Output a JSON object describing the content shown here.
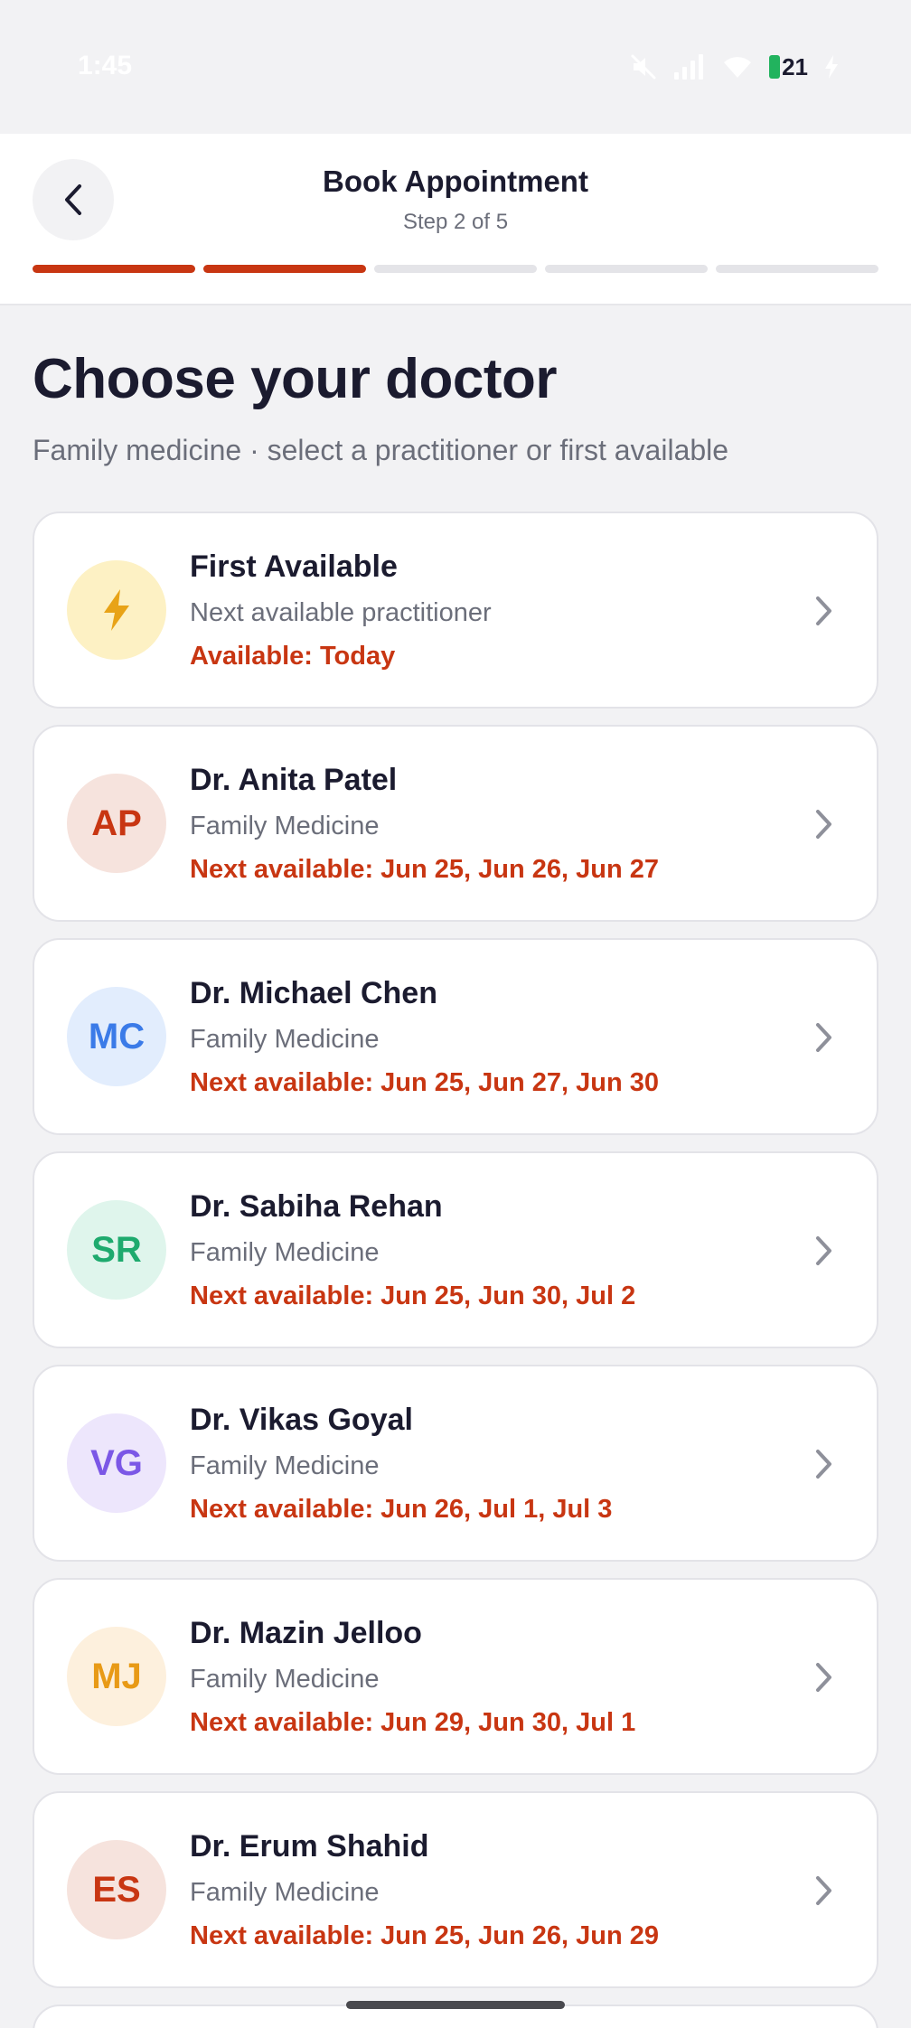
{
  "status_bar": {
    "time": "1:45",
    "battery_level": "21",
    "icons": [
      "mute-icon",
      "signal-icon",
      "wifi-icon",
      "battery-icon",
      "charging-icon"
    ]
  },
  "header": {
    "title": "Book Appointment",
    "step": "Step 2 of 5",
    "progress": {
      "current": 2,
      "total": 5
    },
    "accent_color": "#c83612"
  },
  "main": {
    "title": "Choose your doctor",
    "subtitle": "Family medicine · select a practitioner or first available"
  },
  "options": [
    {
      "type": "first_available",
      "icon": "lightning-icon",
      "name": "First Available",
      "specialty": "Next available practitioner",
      "availability": "Available: Today",
      "avatar_bg": "#fdf1c4",
      "avatar_fg": "#e8a317"
    },
    {
      "type": "doctor",
      "initials": "AP",
      "name": "Dr. Anita Patel",
      "specialty": "Family Medicine",
      "availability": "Next available: Jun 25, Jun 26, Jun 27",
      "avatar_bg": "#f6e3dd",
      "avatar_fg": "#c83612"
    },
    {
      "type": "doctor",
      "initials": "MC",
      "name": "Dr. Michael Chen",
      "specialty": "Family Medicine",
      "availability": "Next available: Jun 25, Jun 27, Jun 30",
      "avatar_bg": "#e2edfd",
      "avatar_fg": "#3b7be8"
    },
    {
      "type": "doctor",
      "initials": "SR",
      "name": "Dr. Sabiha Rehan",
      "specialty": "Family Medicine",
      "availability": "Next available: Jun 25, Jun 30, Jul 2",
      "avatar_bg": "#dff5ec",
      "avatar_fg": "#1eaa6e"
    },
    {
      "type": "doctor",
      "initials": "VG",
      "name": "Dr. Vikas Goyal",
      "specialty": "Family Medicine",
      "availability": "Next available: Jun 26, Jul 1, Jul 3",
      "avatar_bg": "#ede6fc",
      "avatar_fg": "#7b57e6"
    },
    {
      "type": "doctor",
      "initials": "MJ",
      "name": "Dr. Mazin Jelloo",
      "specialty": "Family Medicine",
      "availability": "Next available: Jun 29, Jun 30, Jul 1",
      "avatar_bg": "#fdf0dd",
      "avatar_fg": "#e89a16"
    },
    {
      "type": "doctor",
      "initials": "ES",
      "name": "Dr. Erum Shahid",
      "specialty": "Family Medicine",
      "availability": "Next available: Jun 25, Jun 26, Jun 29",
      "avatar_bg": "#f6e3dd",
      "avatar_fg": "#c83612"
    }
  ]
}
